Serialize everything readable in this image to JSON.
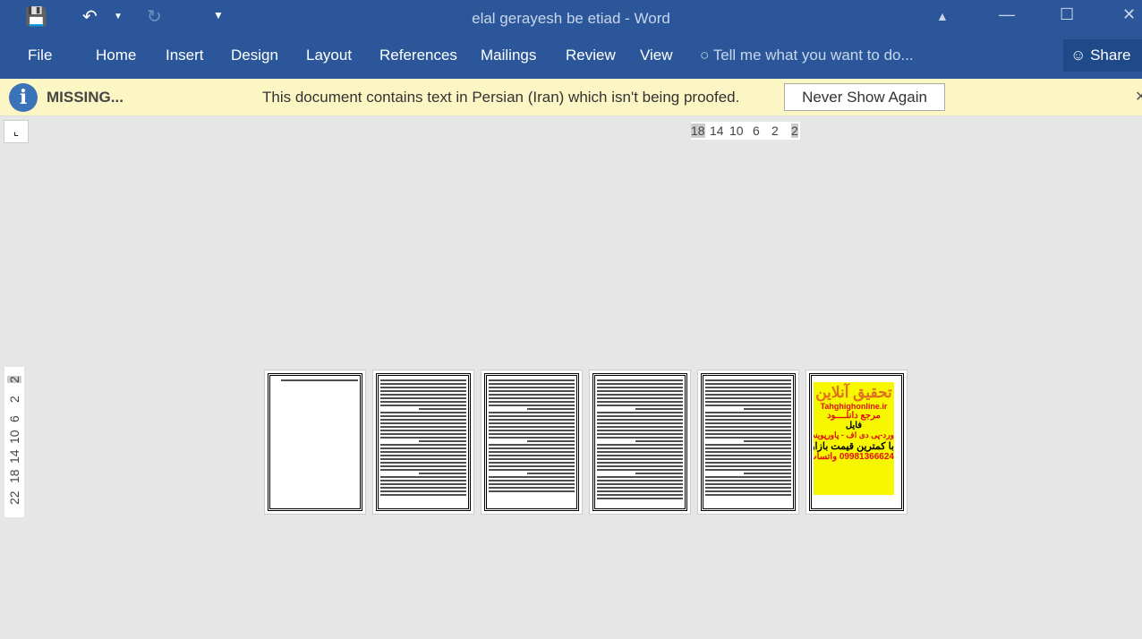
{
  "titlebar": {
    "title": "elal gerayesh be etiad - Word",
    "save_icon": "save-icon",
    "undo_icon": "undo-icon",
    "redo_icon": "redo-icon",
    "customize_icon": "customize-qat-icon"
  },
  "tabs": [
    "File",
    "Home",
    "Insert",
    "Design",
    "Layout",
    "References",
    "Mailings",
    "Review",
    "View"
  ],
  "tell_me": "Tell me what you want to do...",
  "share": "Share",
  "message_bar": {
    "title": "MISSING...",
    "text": "This document contains text in Persian (Iran) which isn't being proofed.",
    "button": "Never Show Again"
  },
  "ruler": {
    "horizontal": [
      "18",
      "14",
      "10",
      "6",
      "2",
      "2"
    ],
    "vertical": [
      "22",
      "18",
      "14",
      "10",
      "6",
      "2",
      "2"
    ]
  },
  "ad_page": {
    "title": "تحقیق آنلاین",
    "site": "Tahghighonline.ir",
    "line1": "مرجع دانلــــود",
    "line2": "فایل",
    "line3": "ورد-پی دی اف - پاورپوینت",
    "line4": "با کمترین قیمت بازار",
    "line5": "09981366624 واتساپ"
  },
  "colors": {
    "ribbon": "#2b579a",
    "message_bar": "#fcf6c4"
  }
}
